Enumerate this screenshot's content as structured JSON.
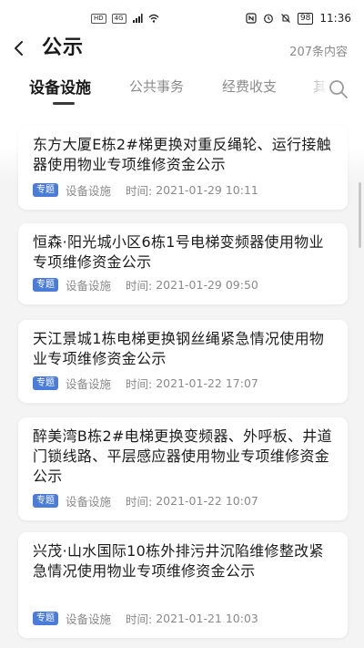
{
  "status_bar": {
    "hd": "HD",
    "net": "4G",
    "battery": "98",
    "time": "11:36"
  },
  "header": {
    "title": "公示",
    "count": "207条内容"
  },
  "tabs": [
    {
      "label": "设备设施",
      "active": true
    },
    {
      "label": "公共事务",
      "active": false
    },
    {
      "label": "经费收支",
      "active": false
    },
    {
      "label": "其",
      "active": false
    }
  ],
  "items": [
    {
      "title": "东方大厦E栋2#梯更换对重反绳轮、运行接触器使用物业专项维修资金公示",
      "badge": "专题",
      "category": "设备设施",
      "time_label": "时间:",
      "time": "2021-01-29 10:11"
    },
    {
      "title": "恒森·阳光城小区6栋1号电梯变频器使用物业专项维修资金公示",
      "badge": "专题",
      "category": "设备设施",
      "time_label": "时间:",
      "time": "2021-01-29 09:50"
    },
    {
      "title": "天江景城1栋电梯更换钢丝绳紧急情况使用物业专项维修资金公示",
      "badge": "专题",
      "category": "设备设施",
      "time_label": "时间:",
      "time": "2021-01-22 17:07"
    },
    {
      "title": "醉美湾B栋2#电梯更换变频器、外呼板、井道门锁线路、平层感应器使用物业专项维修资金公示",
      "badge": "专题",
      "category": "设备设施",
      "time_label": "时间:",
      "time": "2021-01-22 10:07"
    },
    {
      "title": "兴茂·山水国际10栋外排污井沉陷维修整改紧急情况使用物业专项维修资金公示",
      "badge": "专题",
      "category": "设备设施",
      "time_label": "时间:",
      "time": "2021-01-21 10:03"
    }
  ],
  "colors": {
    "badge": "#4a7cd8",
    "background": "#f4f4f4"
  }
}
